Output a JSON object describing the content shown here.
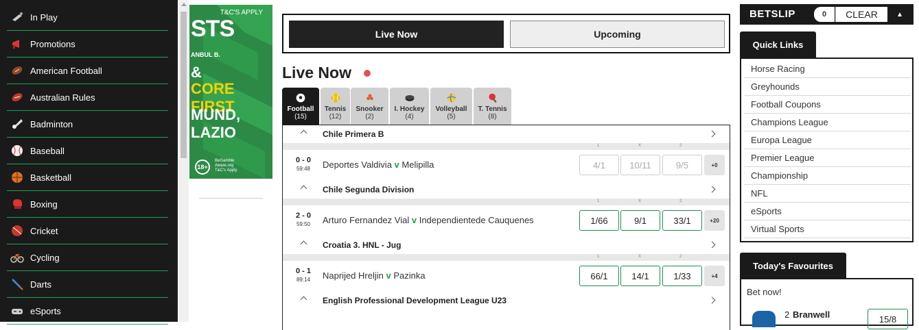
{
  "sidebar": {
    "items": [
      {
        "label": "In Play",
        "icon": "in-play-icon"
      },
      {
        "label": "Promotions",
        "icon": "megaphone-icon"
      },
      {
        "label": "American Football",
        "icon": "american-football-icon"
      },
      {
        "label": "Australian Rules",
        "icon": "australian-rules-ball-icon"
      },
      {
        "label": "Badminton",
        "icon": "shuttlecock-icon"
      },
      {
        "label": "Baseball",
        "icon": "baseball-icon"
      },
      {
        "label": "Basketball",
        "icon": "basketball-icon"
      },
      {
        "label": "Boxing",
        "icon": "boxing-glove-icon"
      },
      {
        "label": "Cricket",
        "icon": "cricket-ball-icon"
      },
      {
        "label": "Cycling",
        "icon": "bicycle-icon"
      },
      {
        "label": "Darts",
        "icon": "dart-icon"
      },
      {
        "label": "eSports",
        "icon": "gamepad-icon"
      }
    ]
  },
  "banner": {
    "tc": "T&C'S APPLY",
    "line1": "STS",
    "line2": "ANBUL B.",
    "line3": "&",
    "line4": "CORE FIRST",
    "line5": "MUND, LAZIO",
    "age": "18+",
    "gamble_aware": [
      "BeGamble",
      "Aware.org",
      "T&C's Apply"
    ]
  },
  "toggle": {
    "live": "Live Now",
    "upcoming": "Upcoming"
  },
  "live_title": "Live Now",
  "sport_tabs": [
    {
      "name": "Football",
      "count": "(15)",
      "icon": "football-icon",
      "active": true
    },
    {
      "name": "Tennis",
      "count": "(12)",
      "icon": "tennis-ball-icon",
      "active": false
    },
    {
      "name": "Snooker",
      "count": "(2)",
      "icon": "snooker-balls-icon",
      "active": false
    },
    {
      "name": "I. Hockey",
      "count": "(4)",
      "icon": "hockey-puck-icon",
      "active": false
    },
    {
      "name": "Volleyball",
      "count": "(5)",
      "icon": "volleyball-icon",
      "active": false
    },
    {
      "name": "T. Tennis",
      "count": "(8)",
      "icon": "table-tennis-icon",
      "active": false
    }
  ],
  "market_cols": [
    "1",
    "X",
    "2"
  ],
  "leagues": [
    {
      "name": "Chile Primera B",
      "event": {
        "score": "0 - 0",
        "time": "59:48",
        "home": "Deportes Valdivia",
        "vs": "v",
        "away": "Melipilla",
        "odds": [
          "4/1",
          "10/11",
          "9/5"
        ],
        "disabled": true,
        "more": "+0"
      }
    },
    {
      "name": "Chile Segunda Division",
      "event": {
        "score": "2 - 0",
        "time": "59:50",
        "home": "Arturo Fernandez Vial",
        "vs": "v",
        "away": "Independientede Cauquenes",
        "odds": [
          "1/66",
          "9/1",
          "33/1"
        ],
        "disabled": false,
        "more": "+20"
      }
    },
    {
      "name": "Croatia 3. HNL - Jug",
      "event": {
        "score": "0 - 1",
        "time": "89:14",
        "home": "Naprijed Hreljin",
        "vs": "v",
        "away": "Pazinka",
        "odds": [
          "66/1",
          "14/1",
          "1/33"
        ],
        "disabled": false,
        "more": "+4"
      }
    },
    {
      "name": "English Professional Development League U23"
    }
  ],
  "betslip": {
    "title": "BETSLIP",
    "count": "0",
    "clear": "CLEAR"
  },
  "quick_links": {
    "title": "Quick Links",
    "items": [
      "Horse Racing",
      "Greyhounds",
      "Football Coupons",
      "Champions League",
      "Europa League",
      "Premier League",
      "Championship",
      "NFL",
      "eSports",
      "Virtual Sports"
    ]
  },
  "favourites": {
    "title": "Today's Favourites",
    "bet_now": "Bet now!",
    "runner_number": "2",
    "runner_name": "Branwell",
    "odds": "15/8"
  },
  "colors": {
    "accent": "#1fa35a",
    "dark": "#1a1a1a",
    "live_dot": "#e05252"
  }
}
